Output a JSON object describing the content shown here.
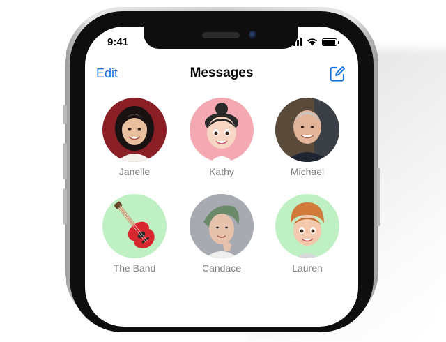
{
  "status_bar": {
    "time": "9:41"
  },
  "nav": {
    "edit_label": "Edit",
    "title": "Messages"
  },
  "contacts": [
    {
      "name": "Janelle",
      "bg": "#8a1f25"
    },
    {
      "name": "Kathy",
      "bg": "#f4a9b2"
    },
    {
      "name": "Michael",
      "bg": "#3a3f48"
    },
    {
      "name": "The Band",
      "bg": "#bff0c4"
    },
    {
      "name": "Candace",
      "bg": "#9a9ca0"
    },
    {
      "name": "Lauren",
      "bg": "#bff0c4"
    }
  ],
  "colors": {
    "accent": "#1a73d9",
    "name_text": "#7d7d7d"
  }
}
